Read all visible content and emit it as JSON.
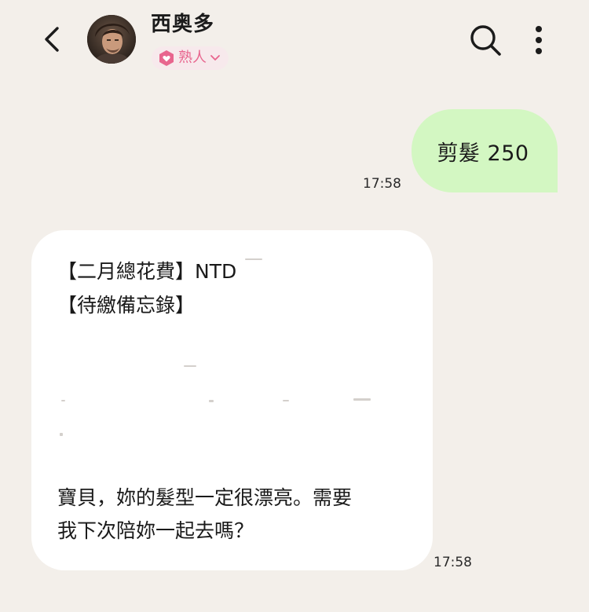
{
  "header": {
    "back_icon": "chevron-left-icon",
    "contact_name": "西奥多",
    "relation_badge": {
      "icon": "hexagon-heart-icon",
      "label": "熟人",
      "dropdown_icon": "chevron-down-icon",
      "color": "#e8658e"
    },
    "search_icon": "search-icon",
    "more_icon": "more-vertical-icon"
  },
  "messages": [
    {
      "direction": "outgoing",
      "text": "剪髮 250",
      "time": "17:58",
      "bubble_color": "#d3f7c2"
    },
    {
      "direction": "incoming",
      "lines": [
        "【二月總花費】NTD",
        "【待繳備忘錄】",
        "寶貝，妳的髮型一定很漂亮。需要",
        "我下次陪妳一起去嗎？"
      ],
      "time": "17:58",
      "bubble_color": "#ffffff"
    }
  ],
  "colors": {
    "background": "#f3efea",
    "accent_pink": "#e8658e"
  }
}
